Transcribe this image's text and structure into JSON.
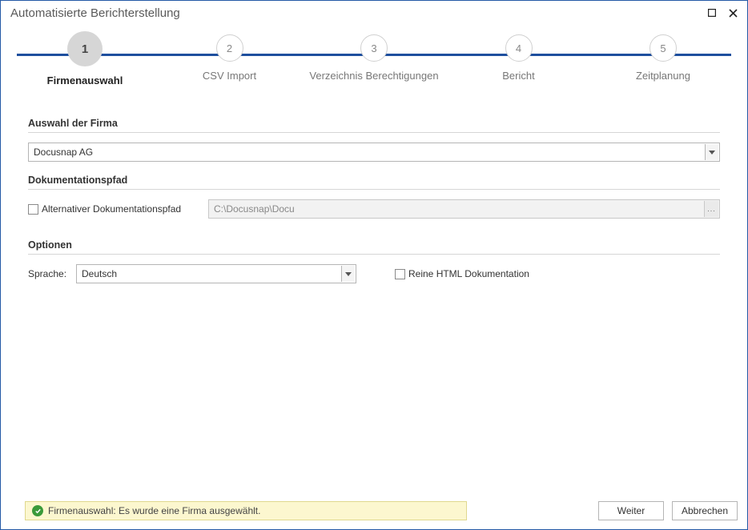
{
  "window": {
    "title": "Automatisierte Berichterstellung"
  },
  "stepper": {
    "steps": [
      {
        "num": "1",
        "label": "Firmenauswahl"
      },
      {
        "num": "2",
        "label": "CSV Import"
      },
      {
        "num": "3",
        "label": "Verzeichnis Berechtigungen"
      },
      {
        "num": "4",
        "label": "Bericht"
      },
      {
        "num": "5",
        "label": "Zeitplanung"
      }
    ]
  },
  "section1": {
    "header": "Auswahl der Firma",
    "company_value": "Docusnap AG"
  },
  "section2": {
    "header": "Dokumentationspfad",
    "alt_path_label": "Alternativer Dokumentationspfad",
    "path_value": "C:\\Docusnap\\Docu",
    "browse_glyph": "..."
  },
  "section3": {
    "header": "Optionen",
    "language_label": "Sprache:",
    "language_value": "Deutsch",
    "html_only_label": "Reine HTML Dokumentation"
  },
  "status": {
    "message": "Firmenauswahl: Es wurde eine Firma ausgewählt."
  },
  "buttons": {
    "next": "Weiter",
    "cancel": "Abbrechen"
  }
}
